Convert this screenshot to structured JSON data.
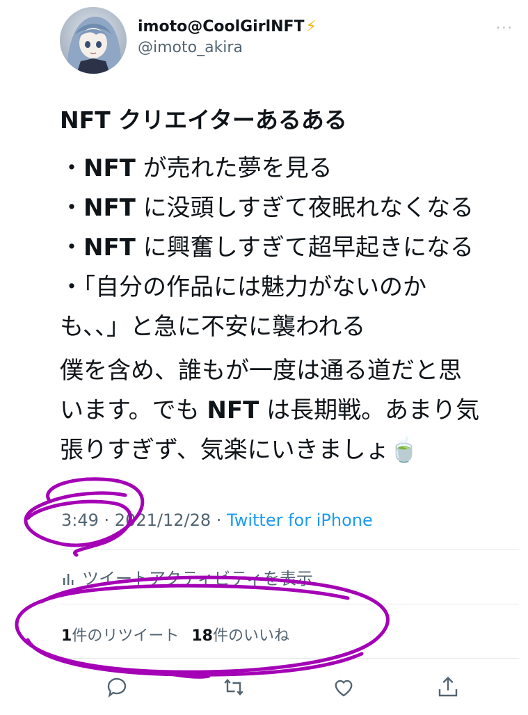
{
  "user": {
    "display_name": "imoto@CoolGirlNFT",
    "verified_glyph": "⚡",
    "handle": "@imoto_akira",
    "avatar_icon": "anime-girl-avatar"
  },
  "more_glyph": "···",
  "tweet": {
    "title": "NFT クリエイターあるある",
    "lines": [
      {
        "prefix": "・",
        "bold": "NFT",
        "rest": " が売れた夢を見る"
      },
      {
        "prefix": "・",
        "bold": "NFT",
        "rest": " に没頭しすぎて夜眠れなくなる"
      },
      {
        "prefix": "・",
        "bold": "NFT",
        "rest": " に興奮しすぎて超早起きになる"
      },
      {
        "prefix": "・",
        "bold": "",
        "rest": "「自分の作品には魅力がないのか"
      },
      {
        "prefix": "",
        "bold": "",
        "rest": "も、、」と急に不安に襲われる"
      }
    ],
    "para2": [
      {
        "pre": "僕を含め、誰もが一度は通る道だと思",
        "bold": "",
        "post": ""
      },
      {
        "pre": "います。でも ",
        "bold": "NFT",
        "post": " は長期戦。あまり気"
      },
      {
        "pre": "張りすぎず、気楽にいきましょ",
        "bold": "",
        "post": "🍵"
      }
    ]
  },
  "meta": {
    "time": "3:49",
    "sep1": " · ",
    "date": "2021/12/28",
    "sep2": " · ",
    "source": "Twitter for iPhone"
  },
  "activity_label": "ツイートアクティビティを表示",
  "stats": {
    "retweet_count": "1",
    "retweet_label": "件のリツイート",
    "like_count": "18",
    "like_label": "件のいいね"
  },
  "colors": {
    "link": "#1d9bf0",
    "muted": "#536471",
    "annotation": "#a400b5"
  },
  "actions": [
    "reply-icon",
    "retweet-icon",
    "like-icon",
    "share-icon"
  ]
}
